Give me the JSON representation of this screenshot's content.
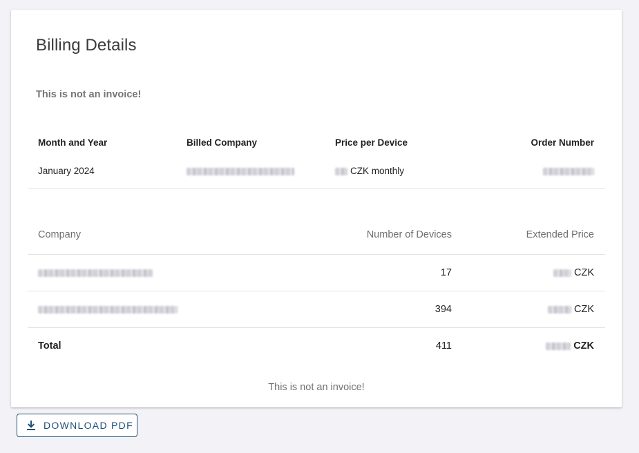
{
  "page": {
    "title": "Billing Details",
    "warning": "This is not an invoice!",
    "footer_note": "This is not an invoice!"
  },
  "meta": {
    "headers": [
      "Month and Year",
      "Billed Company",
      "Price per Device",
      "Order Number"
    ],
    "month_year": "January 2024",
    "billed_company": "",
    "price_per_device_suffix": "CZK monthly",
    "order_number": ""
  },
  "table": {
    "headers": [
      "Company",
      "Number of Devices",
      "Extended Price"
    ],
    "rows": [
      {
        "company": "",
        "devices": "17",
        "price_suffix": "CZK"
      },
      {
        "company": "",
        "devices": "394",
        "price_suffix": "CZK"
      }
    ],
    "total": {
      "label": "Total",
      "devices": "411",
      "price_suffix": "CZK"
    }
  },
  "actions": {
    "download_label": "DOWNLOAD PDF",
    "download_icon": "download-icon"
  },
  "colors": {
    "accent": "#1f4e79",
    "background": "#f3f3f7",
    "muted_text": "#757575"
  }
}
